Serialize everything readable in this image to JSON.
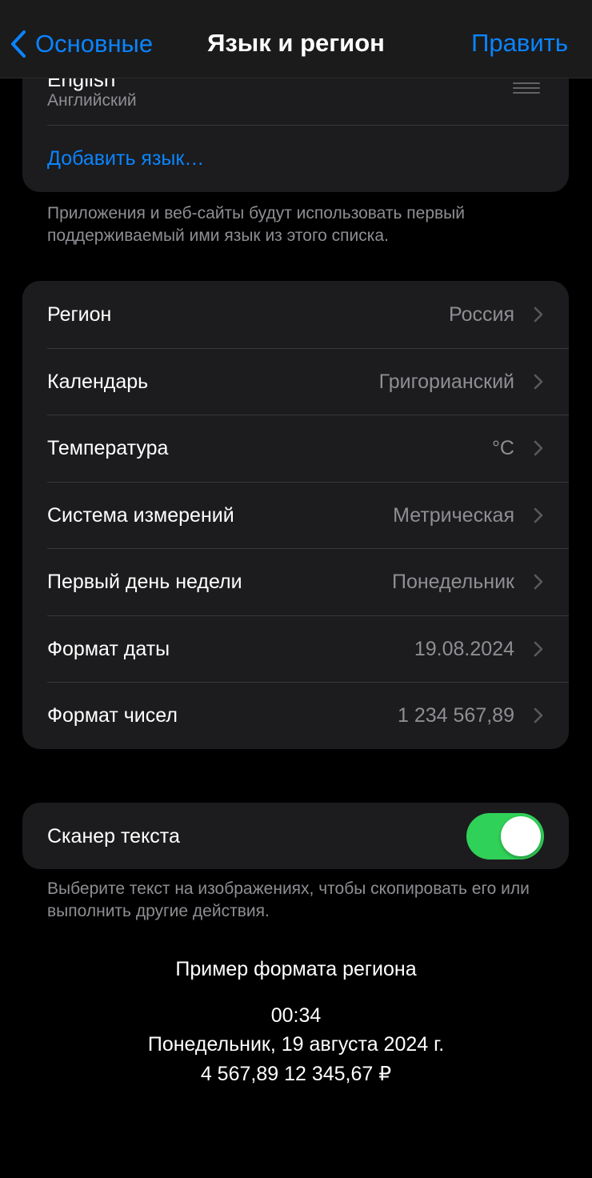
{
  "nav": {
    "back_label": "Основные",
    "title": "Язык и регион",
    "edit_label": "Править"
  },
  "languages": {
    "items": [
      {
        "name": "English",
        "subtitle": "Английский"
      }
    ],
    "add_label": "Добавить язык…",
    "footer": "Приложения и веб-сайты будут использовать первый поддерживаемый ими язык из этого списка."
  },
  "settings": {
    "rows": [
      {
        "label": "Регион",
        "value": "Россия"
      },
      {
        "label": "Календарь",
        "value": "Григорианский"
      },
      {
        "label": "Температура",
        "value": "°C"
      },
      {
        "label": "Система измерений",
        "value": "Метрическая"
      },
      {
        "label": "Первый день недели",
        "value": "Понедельник"
      },
      {
        "label": "Формат даты",
        "value": "19.08.2024"
      },
      {
        "label": "Формат чисел",
        "value": "1 234 567,89"
      }
    ]
  },
  "text_scanner": {
    "label": "Сканер текста",
    "enabled": true,
    "footer": "Выберите текст на изображениях, чтобы скопировать его или выполнить другие действия."
  },
  "region_example": {
    "title": "Пример формата региона",
    "time": "00:34",
    "date": "Понедельник, 19 августа 2024 г.",
    "numbers": "4 567,89 12 345,67 ₽"
  },
  "colors": {
    "accent": "#0a84ff",
    "toggle_on": "#30d158",
    "background": "#000000",
    "card": "#1c1c1e",
    "secondary_text": "#8e8e93"
  }
}
